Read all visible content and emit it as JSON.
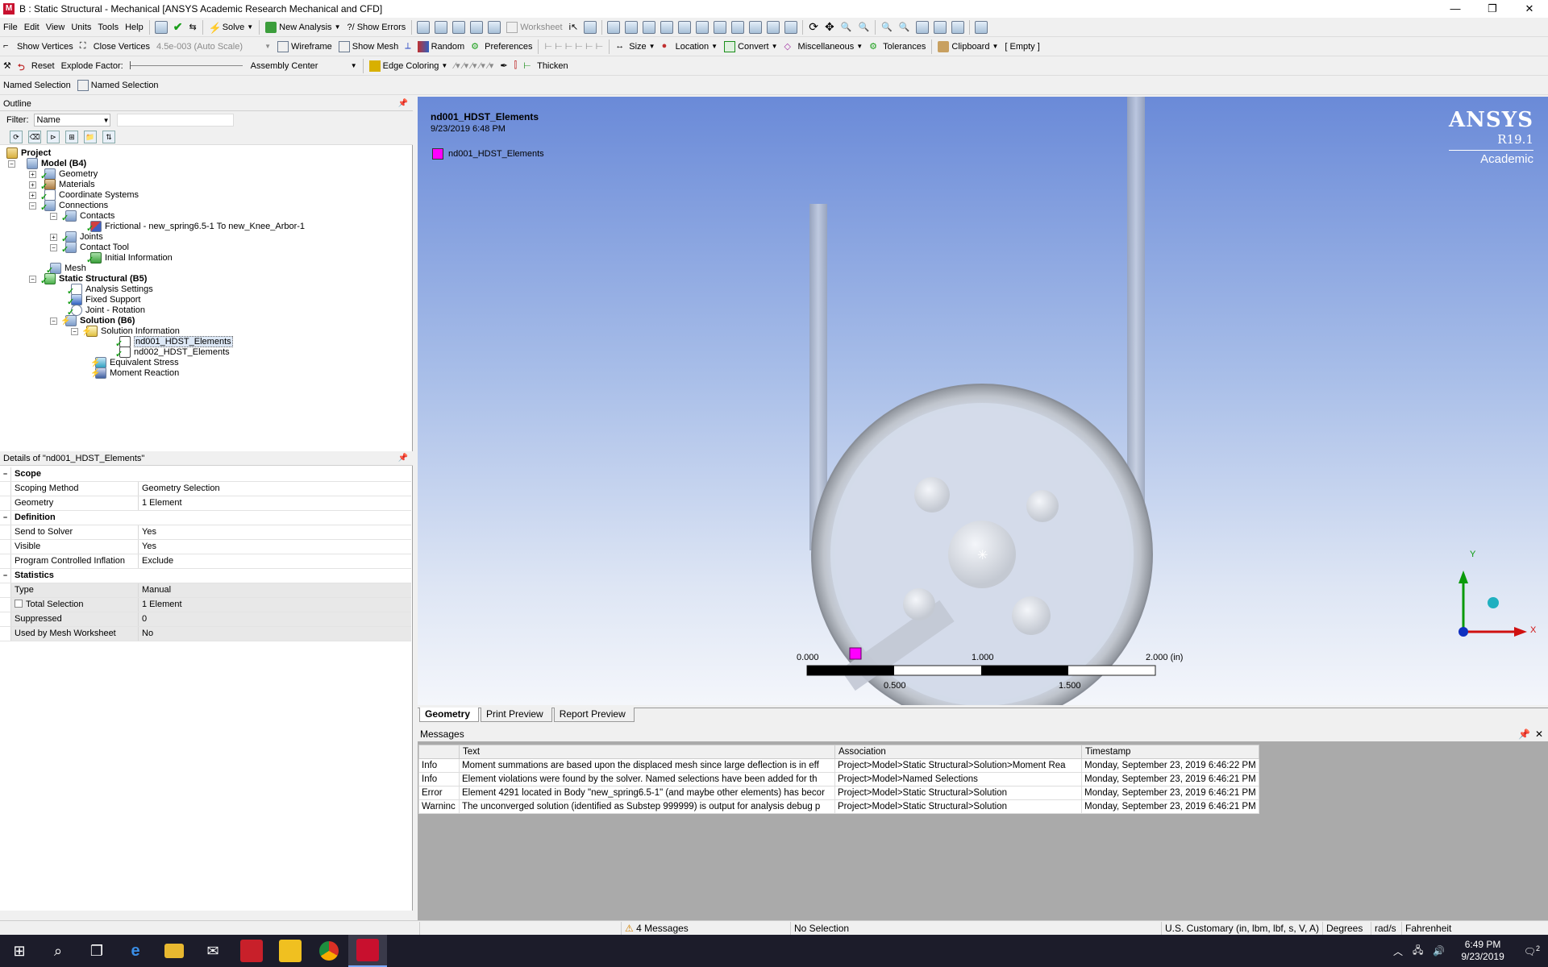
{
  "window": {
    "title": "B : Static Structural - Mechanical [ANSYS Academic Research Mechanical and CFD]",
    "app_icon_letter": "M",
    "controls": [
      "—",
      "❐",
      "✕"
    ]
  },
  "menubar": {
    "items": [
      "File",
      "Edit",
      "View",
      "Units",
      "Tools",
      "Help"
    ],
    "solve": "Solve",
    "new_analysis": "New Analysis",
    "show_errors": "?/ Show Errors",
    "worksheet": "Worksheet"
  },
  "toolbar2": {
    "show_vertices": "Show Vertices",
    "close_vertices": "Close Vertices",
    "scale": "4.5e-003 (Auto Scale)",
    "wireframe": "Wireframe",
    "show_mesh": "Show Mesh",
    "random": "Random",
    "preferences": "Preferences",
    "size": "Size",
    "location": "Location",
    "convert": "Convert",
    "miscellaneous": "Miscellaneous",
    "tolerances": "Tolerances",
    "clipboard": "Clipboard",
    "clipboard_state": "[ Empty ]"
  },
  "toolbar3": {
    "reset": "Reset",
    "explode_factor": "Explode Factor:",
    "assembly_center": "Assembly Center",
    "edge_coloring": "Edge Coloring",
    "thicken": "Thicken"
  },
  "toolbar4": {
    "named_selection_1": "Named Selection",
    "named_selection_2": "Named Selection"
  },
  "outline": {
    "header": "Outline",
    "filter_label": "Filter:",
    "filter_value": "Name",
    "tree": [
      {
        "label": "Project",
        "bold": true
      },
      {
        "label": "Model (B4)",
        "bold": true
      },
      {
        "label": "Geometry"
      },
      {
        "label": "Materials"
      },
      {
        "label": "Coordinate Systems"
      },
      {
        "label": "Connections"
      },
      {
        "label": "Contacts"
      },
      {
        "label": "Frictional - new_spring6.5-1 To new_Knee_Arbor-1"
      },
      {
        "label": "Joints"
      },
      {
        "label": "Contact Tool"
      },
      {
        "label": "Initial Information"
      },
      {
        "label": "Mesh"
      },
      {
        "label": "Static Structural (B5)",
        "bold": true
      },
      {
        "label": "Analysis Settings"
      },
      {
        "label": "Fixed Support"
      },
      {
        "label": "Joint - Rotation"
      },
      {
        "label": "Solution (B6)",
        "bold": true
      },
      {
        "label": "Solution Information"
      },
      {
        "label": "nd001_HDST_Elements",
        "selected": true
      },
      {
        "label": "nd002_HDST_Elements"
      },
      {
        "label": "Equivalent Stress"
      },
      {
        "label": "Moment Reaction"
      }
    ]
  },
  "details": {
    "header": "Details of \"nd001_HDST_Elements\"",
    "rows": [
      {
        "section": "Scope"
      },
      {
        "key": "Scoping Method",
        "value": "Geometry Selection"
      },
      {
        "key": "Geometry",
        "value": "1 Element"
      },
      {
        "section": "Definition"
      },
      {
        "key": "Send to Solver",
        "value": "Yes"
      },
      {
        "key": "Visible",
        "value": "Yes"
      },
      {
        "key": "Program Controlled Inflation",
        "value": "Exclude"
      },
      {
        "section": "Statistics"
      },
      {
        "key": "Type",
        "value": "Manual",
        "shaded": true
      },
      {
        "key": "Total Selection",
        "value": "1 Element",
        "shaded": true,
        "checkbox": true
      },
      {
        "key": "Suppressed",
        "value": "0",
        "shaded": true
      },
      {
        "key": "Used by Mesh Worksheet",
        "value": "No",
        "shaded": true
      }
    ]
  },
  "viewport": {
    "title": "nd001_HDST_Elements",
    "date": "9/23/2019 6:48 PM",
    "legend_label": "nd001_HDST_Elements",
    "legend_color": "#ff00ff",
    "logo_brand": "ANSYS",
    "logo_version": "R19.1",
    "logo_edition": "Academic",
    "scale_labels_top": [
      "0.000",
      "1.000",
      "2.000 (in)"
    ],
    "scale_labels_bottom": [
      "0.500",
      "1.500"
    ],
    "axis_x": "X",
    "axis_y": "Y"
  },
  "viewport_tabs": [
    "Geometry",
    "Print Preview",
    "Report Preview"
  ],
  "messages": {
    "header": "Messages",
    "columns": [
      "",
      "Text",
      "Association",
      "Timestamp"
    ],
    "rows": [
      [
        "Info",
        "Moment summations are based upon the displaced mesh since large deflection is in eff",
        "Project>Model>Static Structural>Solution>Moment Rea",
        "Monday, September 23, 2019 6:46:22 PM"
      ],
      [
        "Info",
        "Element violations were found by the solver.  Named selections have been added for th",
        "Project>Model>Named Selections",
        "Monday, September 23, 2019 6:46:21 PM"
      ],
      [
        "Error",
        "Element 4291 located in Body \"new_spring6.5-1\" (and maybe other elements) has becor",
        "Project>Model>Static Structural>Solution",
        "Monday, September 23, 2019 6:46:21 PM"
      ],
      [
        "Warninc",
        "The unconverged solution (identified as Substep 999999) is output for analysis debug p",
        "Project>Model>Static Structural>Solution",
        "Monday, September 23, 2019 6:46:21 PM"
      ]
    ]
  },
  "statusbar": {
    "messages": "4 Messages",
    "selection": "No Selection",
    "units": "U.S. Customary (in, lbm, lbf, s, V, A)",
    "angle": "Degrees",
    "rate": "rad/s",
    "temp": "Fahrenheit"
  },
  "taskbar": {
    "time": "6:49 PM",
    "date": "9/23/2019",
    "notifications": "2"
  }
}
